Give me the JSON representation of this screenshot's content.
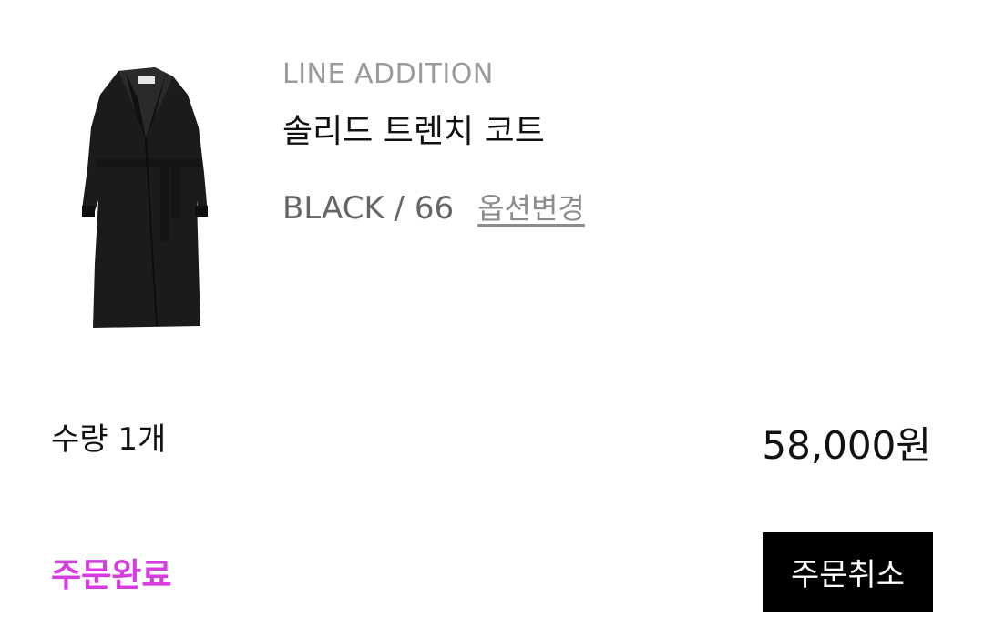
{
  "product": {
    "brand": "LINE ADDITION",
    "name": "솔리드 트렌치 코트",
    "option": "BLACK / 66",
    "option_change_label": "옵션변경",
    "image_icon": "black-trench-coat-image"
  },
  "order": {
    "quantity_text": "수량 1개",
    "price_text": "58,000원",
    "status_text": "주문완료",
    "cancel_label": "주문취소"
  },
  "colors": {
    "status": "#d63ce0",
    "button_bg": "#000000",
    "button_text": "#ffffff",
    "brand_text": "#9a9a9a"
  }
}
